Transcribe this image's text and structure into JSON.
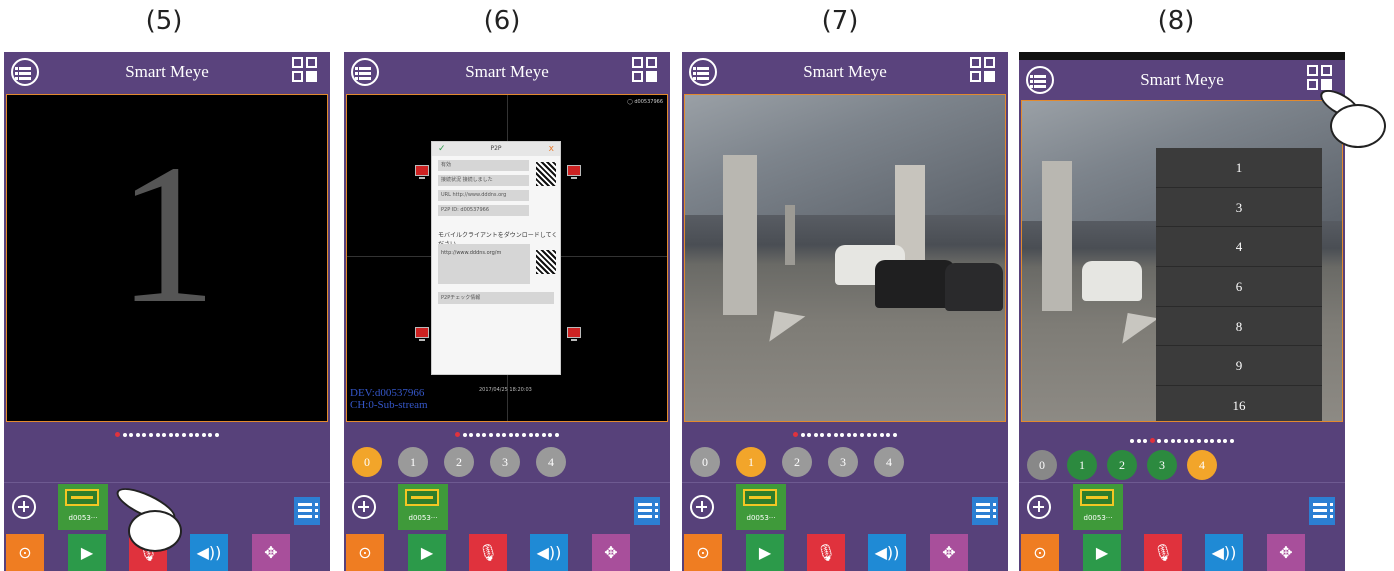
{
  "steps": [
    "(5)",
    "(6)",
    "(7)",
    "(8)"
  ],
  "app_title": "Smart Meye",
  "device_label": "d0053···",
  "phone5": {
    "big_number": "1"
  },
  "phone6": {
    "dialog_title": "P2P",
    "rows": [
      "有効",
      "接続状況  接続しました",
      "URL  http://www.dddns.org",
      "P2P  ID: d00537966"
    ],
    "download_text": "モバイルクライアントをダウンロードしてください",
    "url_box": "http://www.dddns.org/m",
    "check_row": "P2Pチェック情報",
    "dev_id": "DEV:d00537966",
    "channel": "CH:0-Sub-stream",
    "timestamp": "2017/04/25 18:20:03",
    "top_id": "◯ d00537966"
  },
  "channels6": [
    "0",
    "1",
    "2",
    "3",
    "4"
  ],
  "channels7": [
    "0",
    "1",
    "2",
    "3",
    "4"
  ],
  "channels8": [
    "0",
    "1",
    "2",
    "3",
    "4"
  ],
  "layout_menu": [
    "1",
    "3",
    "4",
    "6",
    "8",
    "9",
    "16"
  ],
  "colors": {
    "header": "#5a437d",
    "body": "#57417a",
    "accent": "#e28a2e"
  }
}
